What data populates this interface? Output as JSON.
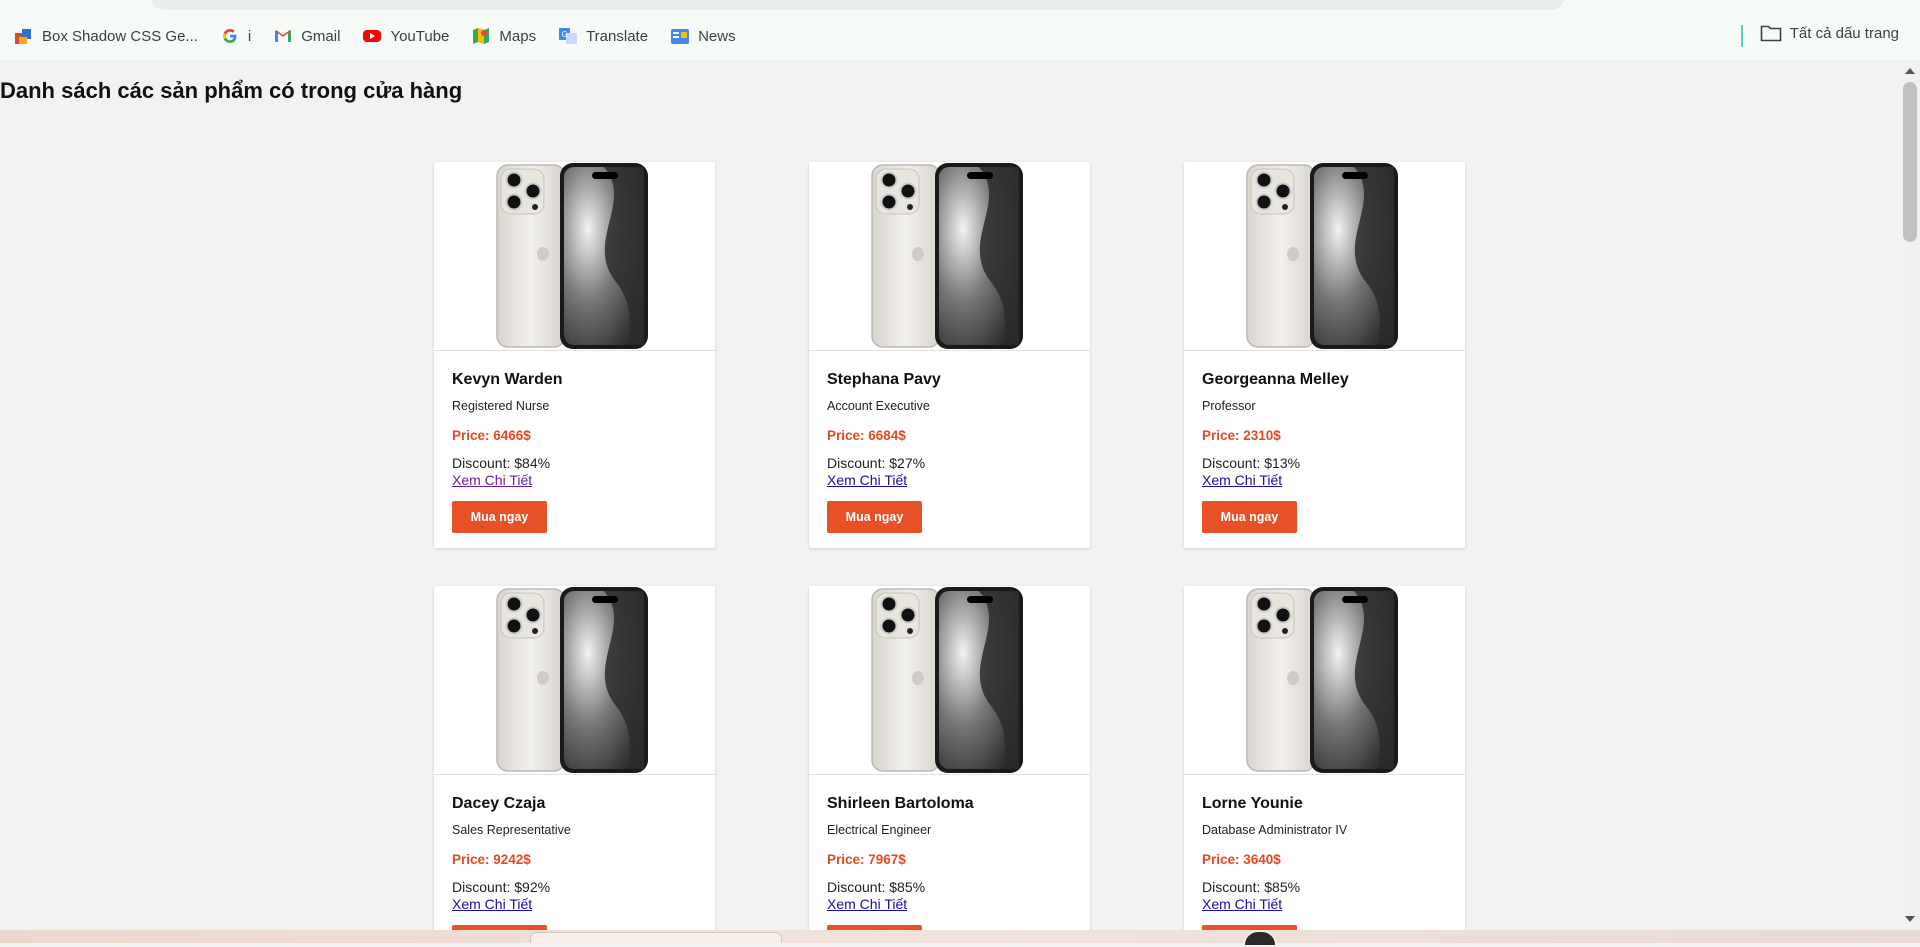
{
  "bookmarks": [
    {
      "label": "Box Shadow CSS Ge...",
      "icon": "box-shadow-icon"
    },
    {
      "label": "i",
      "icon": "google-icon"
    },
    {
      "label": "Gmail",
      "icon": "gmail-icon"
    },
    {
      "label": "YouTube",
      "icon": "youtube-icon"
    },
    {
      "label": "Maps",
      "icon": "maps-icon"
    },
    {
      "label": "Translate",
      "icon": "translate-icon"
    },
    {
      "label": "News",
      "icon": "news-icon"
    }
  ],
  "all_bookmarks_label": "Tất cả dấu trang",
  "page": {
    "title": "Danh sách các sản phẩm có trong cửa hàng",
    "detail_label": "Xem Chi Tiết",
    "buy_label": "Mua ngay"
  },
  "products": [
    {
      "name": "Kevyn Warden",
      "job": "Registered Nurse",
      "price": "Price: 6466$",
      "discount": "Discount: $84%"
    },
    {
      "name": "Stephana Pavy",
      "job": "Account Executive",
      "price": "Price: 6684$",
      "discount": "Discount: $27%"
    },
    {
      "name": "Georgeanna Melley",
      "job": "Professor",
      "price": "Price: 2310$",
      "discount": "Discount: $13%"
    },
    {
      "name": "Dacey Czaja",
      "job": "Sales Representative",
      "price": "Price: 9242$",
      "discount": "Discount: $92%"
    },
    {
      "name": "Shirleen Bartoloma",
      "job": "Electrical Engineer",
      "price": "Price: 7967$",
      "discount": "Discount: $85%"
    },
    {
      "name": "Lorne Younie",
      "job": "Database Administrator IV",
      "price": "Price: 3640$",
      "discount": "Discount: $85%"
    }
  ],
  "colors": {
    "price": "#e4491f",
    "buy_button": "#e85127",
    "link": "#1a0dab",
    "visited_link": "#681da8"
  }
}
